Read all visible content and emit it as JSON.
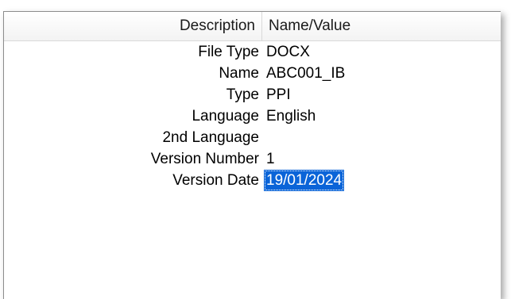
{
  "columns": {
    "description": "Description",
    "value": "Name/Value"
  },
  "rows": [
    {
      "label": "File Type",
      "value": "DOCX"
    },
    {
      "label": "Name",
      "value": "ABC001_IB"
    },
    {
      "label": "Type",
      "value": "PPI"
    },
    {
      "label": "Language",
      "value": "English"
    },
    {
      "label": "2nd Language",
      "value": ""
    },
    {
      "label": "Version Number",
      "value": "1"
    },
    {
      "label": "Version Date",
      "value": "19/01/2024",
      "selected": true
    }
  ],
  "colors": {
    "selection": "#0a64d8",
    "header_background": "#f3f3f3"
  }
}
